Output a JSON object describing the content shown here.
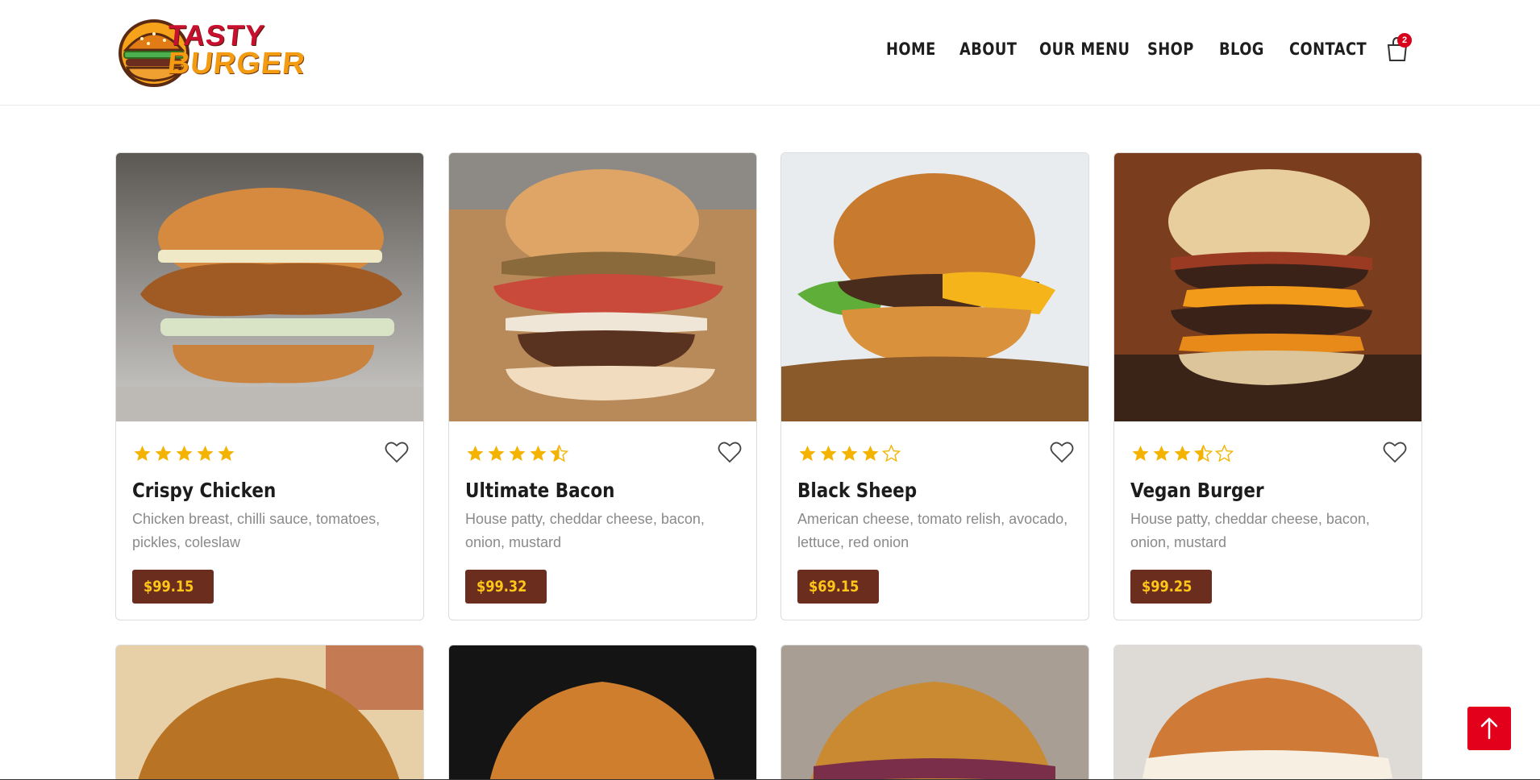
{
  "brand": {
    "logo_top": "TASTY",
    "logo_bottom": "BURGER"
  },
  "nav": {
    "items": [
      {
        "label": "HOME"
      },
      {
        "label": "ABOUT"
      },
      {
        "label": "OUR MENU"
      },
      {
        "label": "SHOP"
      },
      {
        "label": "BLOG"
      },
      {
        "label": "CONTACT"
      }
    ],
    "cart_count": "2",
    "cart_icon": "shopping-bag-icon"
  },
  "colors": {
    "accent_red": "#e3001b",
    "price_bg": "#6b2d1d",
    "price_text": "#ffc61a",
    "star": "#f5b301"
  },
  "products": [
    {
      "name": "Crispy Chicken",
      "description": "Chicken breast, chilli sauce, tomatoes, pickles, coleslaw",
      "price": "$99.15",
      "rating": 5
    },
    {
      "name": "Ultimate Bacon",
      "description": "House patty, cheddar cheese, bacon, onion, mustard",
      "price": "$99.32",
      "rating": 4.5
    },
    {
      "name": "Black Sheep",
      "description": "American cheese, tomato relish, avocado, lettuce, red onion",
      "price": "$69.15",
      "rating": 4
    },
    {
      "name": "Vegan Burger",
      "description": "House patty, cheddar cheese, bacon, onion, mustard",
      "price": "$99.25",
      "rating": 3.5
    }
  ],
  "scroll_top_icon": "arrow-up-icon"
}
